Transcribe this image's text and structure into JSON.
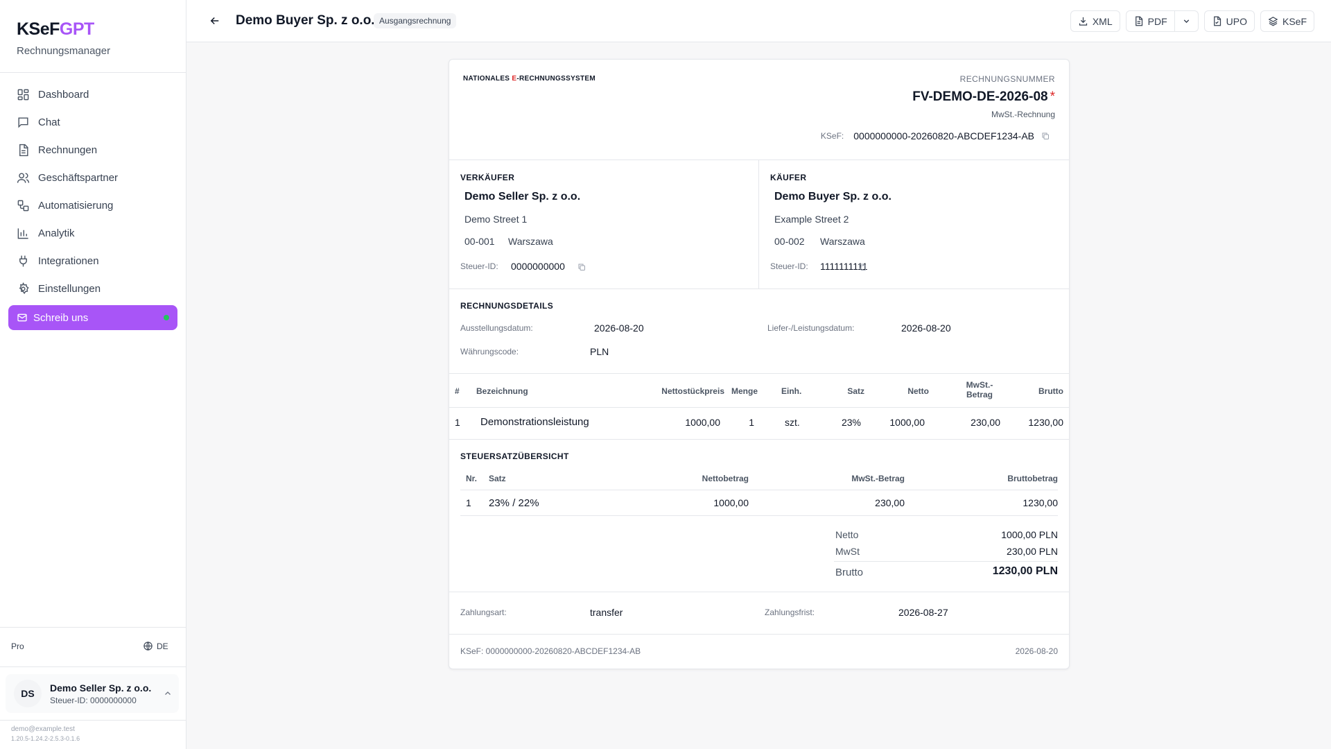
{
  "brand": {
    "logo_main": "KSeF",
    "logo_accent": "GPT",
    "subtitle": "Rechnungsmanager"
  },
  "sidebar": {
    "items": [
      {
        "label": "Dashboard",
        "icon": "dashboard-icon"
      },
      {
        "label": "Chat",
        "icon": "chat-icon"
      },
      {
        "label": "Rechnungen",
        "icon": "document-icon"
      },
      {
        "label": "Geschäftspartner",
        "icon": "users-icon"
      },
      {
        "label": "Automatisierung",
        "icon": "workflow-icon"
      },
      {
        "label": "Analytik",
        "icon": "bar-chart-icon"
      },
      {
        "label": "Integrationen",
        "icon": "plug-icon"
      },
      {
        "label": "Einstellungen",
        "icon": "gear-icon"
      }
    ],
    "cta": {
      "label": "Schreib uns",
      "icon": "mail-icon"
    },
    "plan": "Pro",
    "language": "DE",
    "account": {
      "initials": "DS",
      "name": "Demo Seller Sp. z o.o.",
      "tax_id": "Steuer-ID: 0000000000"
    },
    "email": "demo@example.test",
    "version": "1.20.5-1.24.2-2.5.3-0.1.6"
  },
  "topbar": {
    "title": "Demo Buyer Sp. z o.o.",
    "badge": "Ausgangsrechnung",
    "buttons": {
      "xml": "XML",
      "pdf": "PDF",
      "upo": "UPO",
      "ksef": "KSeF"
    }
  },
  "invoice": {
    "system_label_pre": "NATIONALES ",
    "system_label_red": "E",
    "system_label_post": "-RECHNUNGSSYSTEM",
    "number_caption": "RECHNUNGSNUMMER",
    "number": "FV-DEMO-DE-2026-08",
    "required_mark": "*",
    "type": "MwSt.-Rechnung",
    "ksef_label": "KSeF:",
    "ksef_number": "0000000000-20260820-ABCDEF1234-AB",
    "seller": {
      "title": "VERKÄUFER",
      "name": "Demo Seller Sp. z o.o.",
      "street": "Demo Street 1",
      "postal": "00-001",
      "city": "Warszawa",
      "tax_label": "Steuer-ID:",
      "tax_id": "0000000000"
    },
    "buyer": {
      "title": "KÄUFER",
      "name": "Demo Buyer Sp. z o.o.",
      "street": "Example Street 2",
      "postal": "00-002",
      "city": "Warszawa",
      "tax_label": "Steuer-ID:",
      "tax_id": "1111111111"
    },
    "details": {
      "title": "RECHNUNGSDETAILS",
      "issue_label": "Ausstellungsdatum:",
      "issue_date": "2026-08-20",
      "delivery_label": "Liefer-/Leistungsdatum:",
      "delivery_date": "2026-08-20",
      "currency_label": "Währungscode:",
      "currency": "PLN"
    },
    "items": {
      "headers": {
        "no": "#",
        "name": "Bezeichnung",
        "unit_price": "Nettostückpreis",
        "qty": "Menge",
        "unit": "Einh.",
        "rate": "Satz",
        "net": "Netto",
        "vat_1": "MwSt.-",
        "vat_2": "Betrag",
        "gross": "Brutto"
      },
      "rows": [
        {
          "no": "1",
          "name": "Demonstrationsleistung",
          "unit_price": "1000,00",
          "qty": "1",
          "unit": "szt.",
          "rate": "23%",
          "net": "1000,00",
          "vat": "230,00",
          "gross": "1230,00"
        }
      ]
    },
    "tax_summary": {
      "title": "STEUERSATZÜBERSICHT",
      "headers": {
        "no": "Nr.",
        "rate": "Satz",
        "net": "Nettobetrag",
        "vat": "MwSt.-Betrag",
        "gross": "Bruttobetrag"
      },
      "rows": [
        {
          "no": "1",
          "rate": "23% / 22%",
          "net": "1000,00",
          "vat": "230,00",
          "gross": "1230,00"
        }
      ]
    },
    "totals": {
      "net_label": "Netto",
      "net": "1000,00 PLN",
      "vat_label": "MwSt",
      "vat": "230,00 PLN",
      "gross_label": "Brutto",
      "gross": "1230,00 PLN"
    },
    "payment": {
      "method_label": "Zahlungsart:",
      "method": "transfer",
      "due_label": "Zahlungsfrist:",
      "due": "2026-08-27"
    },
    "footer": {
      "ksef": "KSeF: 0000000000-20260820-ABCDEF1234-AB",
      "date": "2026-08-20"
    }
  },
  "colors": {
    "accent": "#a855f7",
    "status_dot": "#22c55e",
    "required": "#dc2626"
  }
}
